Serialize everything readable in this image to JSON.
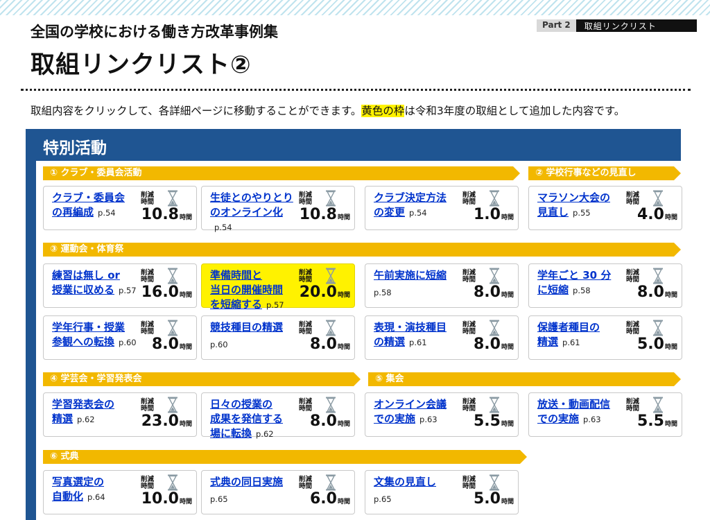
{
  "header": {
    "part_label": "Part 2",
    "part_title": "取組リンクリスト",
    "subtitle": "全国の学校における働き方改革事例集",
    "title": "取組リンクリスト②"
  },
  "intro": {
    "before": "取組内容をクリックして、各詳細ページに移動することができます。",
    "highlight": "黄色の枠",
    "after": "は令和3年度の取組として追加した内容です。"
  },
  "section_title": "特別活動",
  "reduction_label": "削減時間",
  "hour_unit": "時間",
  "categories": {
    "club": "① クラブ・委員会活動",
    "school_events": "② 学校行事などの見直し",
    "sports_day": "③ 運動会・体育祭",
    "presentation": "④ 学芸会・学習発表会",
    "assembly": "⑤ 集会",
    "ceremony": "⑥ 式典"
  },
  "cards": [
    {
      "line1": "クラブ・委員会",
      "line2": "の再編成",
      "page": "p.54",
      "hours": "10.8",
      "highlight": false
    },
    {
      "line1": "生徒とのやりとり",
      "line2": "のオンライン化",
      "page": "p.54",
      "hours": "10.8",
      "highlight": false
    },
    {
      "line1": "クラブ決定方法",
      "line2": "の変更",
      "page": "p.54",
      "hours": "1.0",
      "highlight": false
    },
    {
      "line1": "マラソン大会の",
      "line2": "見直し",
      "page": "p.55",
      "hours": "4.0",
      "highlight": false
    },
    {
      "line1": "練習は無し or",
      "line2": "授業に収める",
      "page": "p.57",
      "hours": "16.0",
      "highlight": false
    },
    {
      "line1": "準備時間と",
      "line2": "当日の開催時間",
      "line3": "を短縮する",
      "page": "p.57",
      "hours": "20.0",
      "highlight": true
    },
    {
      "line1": "午前実施に短縮",
      "line2": "",
      "page": "p.58",
      "hours": "8.0",
      "highlight": false
    },
    {
      "line1": "学年ごと 30 分",
      "line2": "に短縮",
      "page": "p.58",
      "hours": "8.0",
      "highlight": false
    },
    {
      "line1": "学年行事・授業",
      "line2": "参観への転換",
      "page": "p.60",
      "hours": "8.0",
      "highlight": false
    },
    {
      "line1": "競技種目の精選",
      "line2": "",
      "page": "p.60",
      "hours": "8.0",
      "highlight": false
    },
    {
      "line1": "表現・演技種目",
      "line2": "の精選",
      "page": "p.61",
      "hours": "8.0",
      "highlight": false
    },
    {
      "line1": "保護者種目の",
      "line2": "精選",
      "page": "p.61",
      "hours": "5.0",
      "highlight": false
    },
    {
      "line1": "学習発表会の",
      "line2": "精選",
      "page": "p.62",
      "hours": "23.0",
      "highlight": false
    },
    {
      "line1": "日々の授業の",
      "line2": "成果を発信する",
      "line3": "場に転換",
      "page": "p.62",
      "hours": "8.0",
      "highlight": false
    },
    {
      "line1": "オンライン会議",
      "line2": "での実施",
      "page": "p.63",
      "hours": "5.5",
      "highlight": false
    },
    {
      "line1": "放送・動画配信",
      "line2": "での実施",
      "page": "p.63",
      "hours": "5.5",
      "highlight": false
    },
    {
      "line1": "写真選定の",
      "line2": "自動化",
      "page": "p.64",
      "hours": "10.0",
      "highlight": false
    },
    {
      "line1": "式典の同日実施",
      "line2": "",
      "page": "p.65",
      "hours": "6.0",
      "highlight": false
    },
    {
      "line1": "文集の見直し",
      "line2": "",
      "page": "p.65",
      "hours": "5.0",
      "highlight": false
    }
  ]
}
